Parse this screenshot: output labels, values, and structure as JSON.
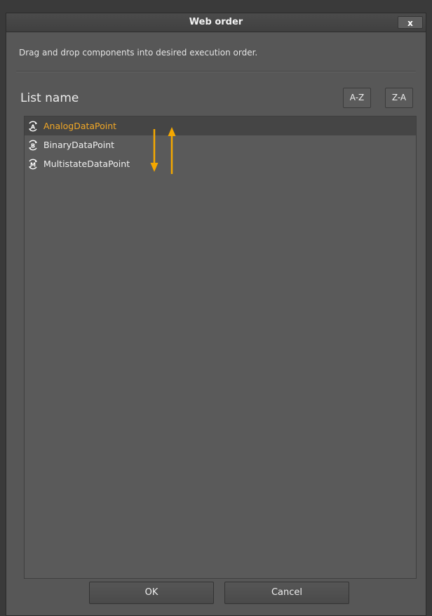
{
  "dialog": {
    "title": "Web order",
    "close_label": "x",
    "description": "Drag and drop components into desired execution order.",
    "list_title": "List name",
    "sort_az": "A-Z",
    "sort_za": "Z-A",
    "ok_label": "OK",
    "cancel_label": "Cancel"
  },
  "list": {
    "items": [
      {
        "label": "AnalogDataPoint",
        "icon_letter": "A",
        "selected": true
      },
      {
        "label": "BinaryDataPoint",
        "icon_letter": "B",
        "selected": false
      },
      {
        "label": "MultistateDataPoint",
        "icon_letter": "M",
        "selected": false
      }
    ]
  },
  "icons": {
    "item_icon": "datapoint-refresh-icon",
    "order_arrows": [
      "arrow-down-icon",
      "arrow-up-icon"
    ]
  },
  "colors": {
    "selected_text": "#f2a826",
    "arrow": "#f5a800"
  }
}
